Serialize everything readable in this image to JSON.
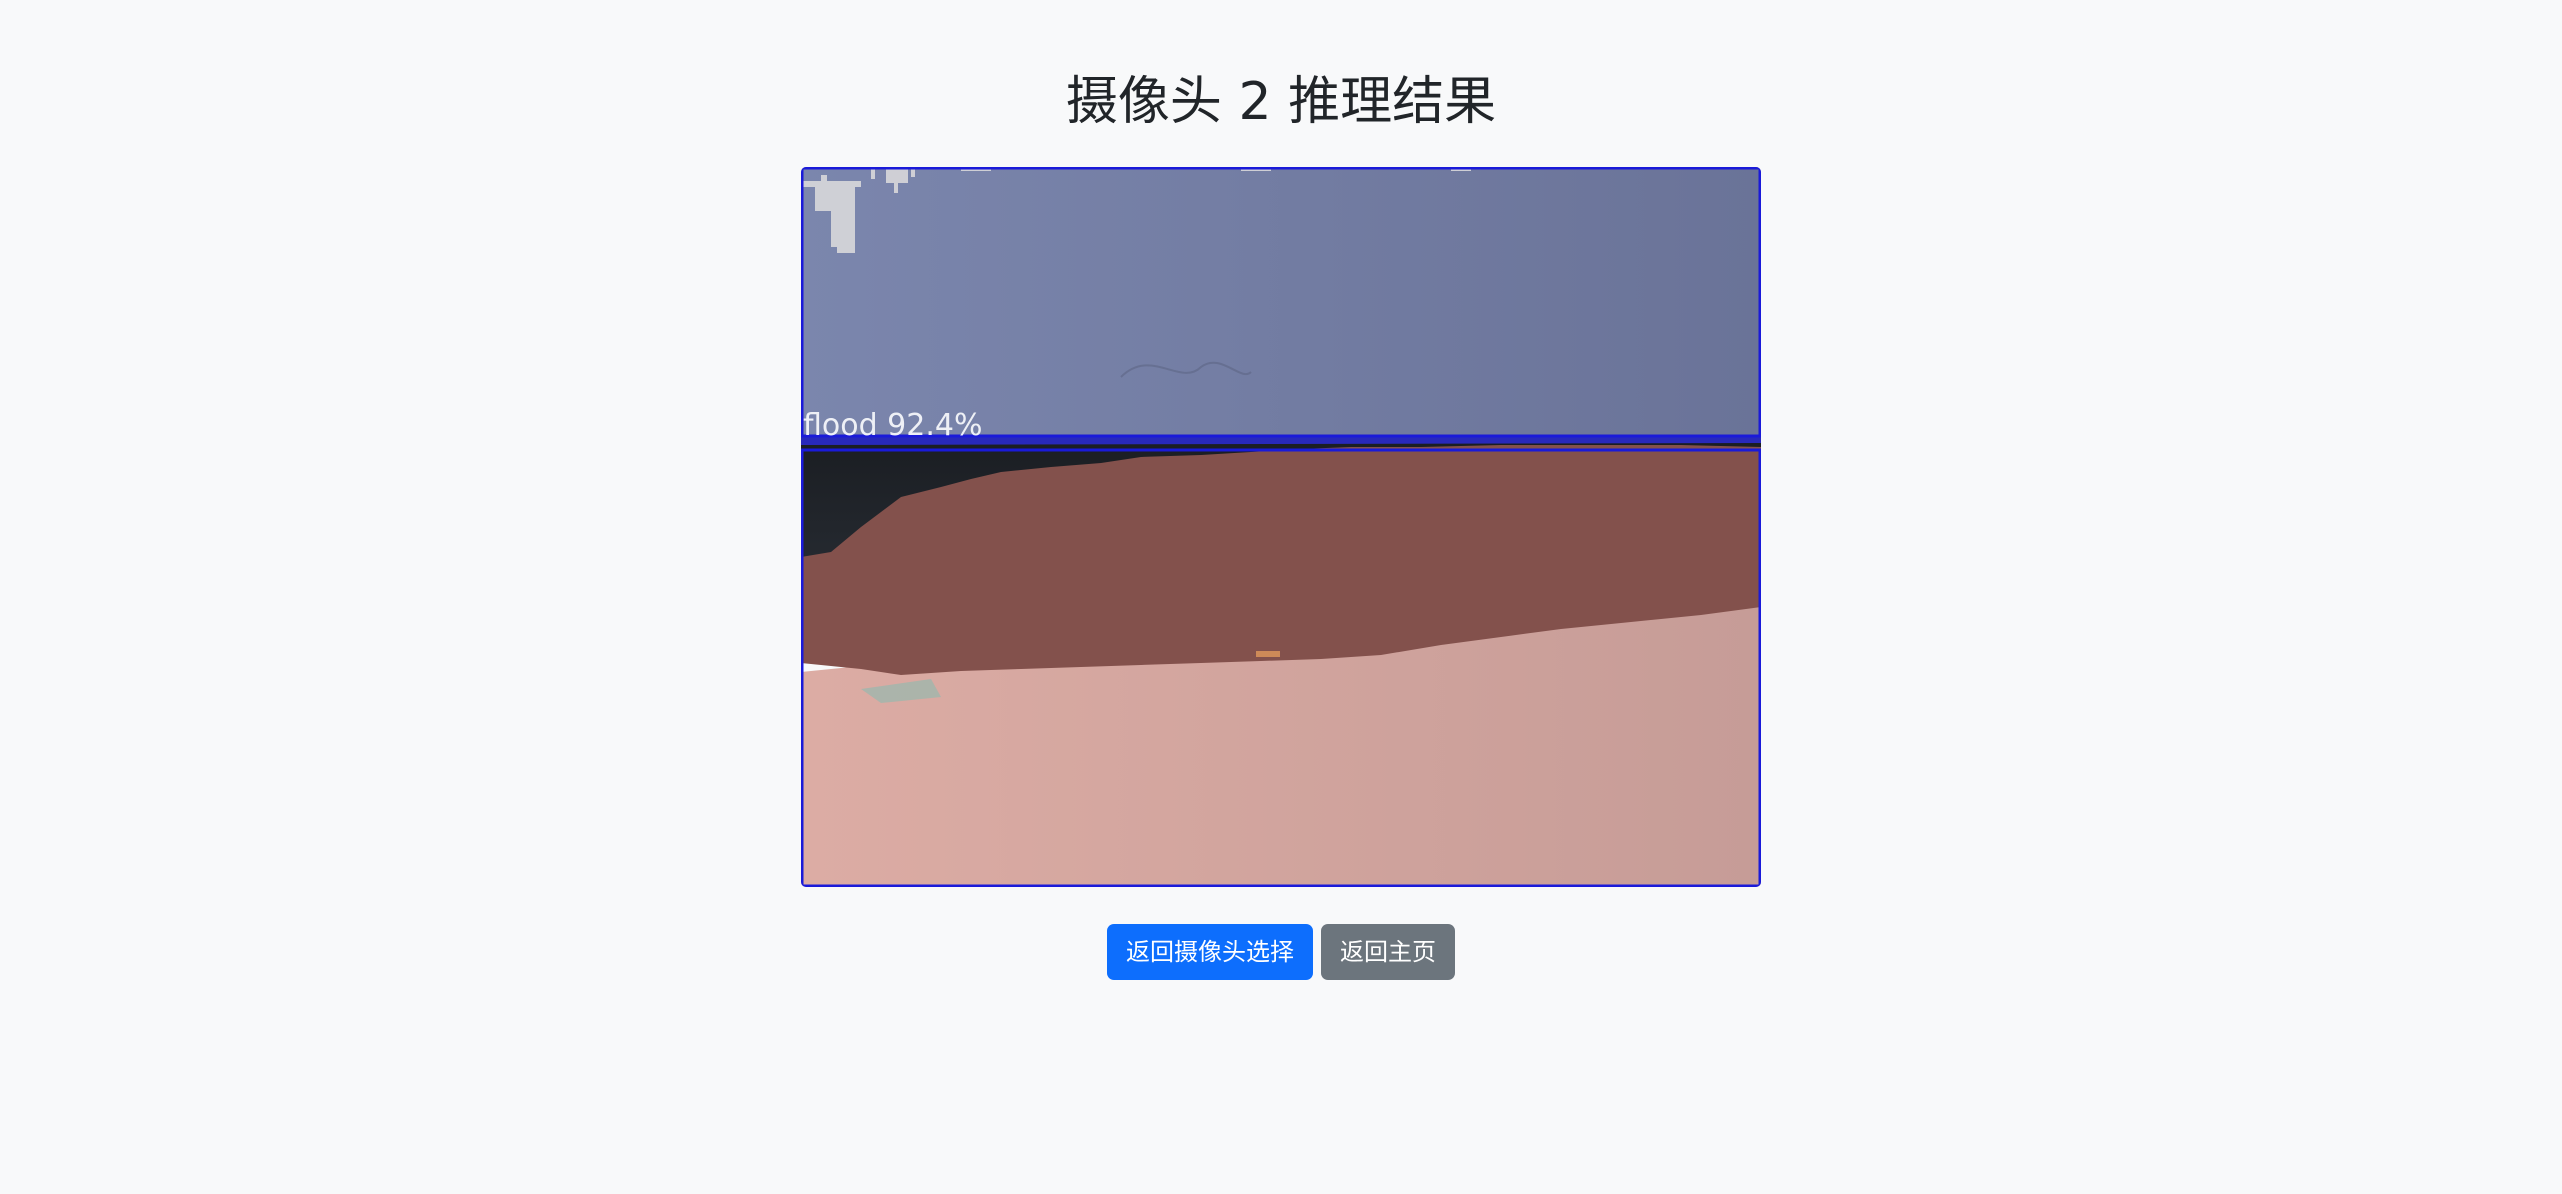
{
  "page": {
    "title": "摄像头 2 推理结果"
  },
  "result_image": {
    "description_label": "flood 92.4%",
    "detections": [
      {
        "label": "flood",
        "confidence": "92.4%"
      }
    ],
    "colors": {
      "box": "#1a1ad9",
      "sky": "#7482a8",
      "vehicle_mask": "#83514c",
      "water_mask": "#d9a9a1"
    }
  },
  "actions": {
    "back_to_camera_select": "返回摄像头选择",
    "back_to_home": "返回主页"
  }
}
